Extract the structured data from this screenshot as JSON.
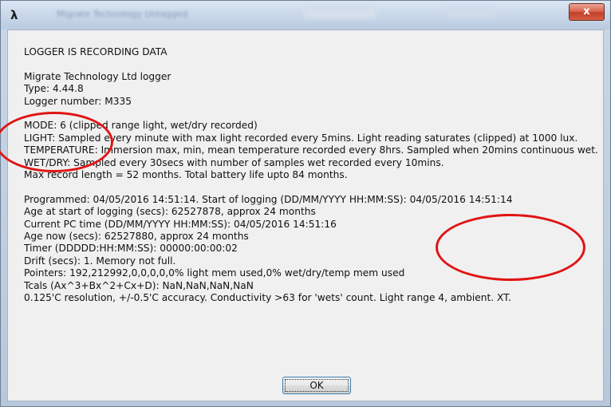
{
  "window": {
    "title": "Migrate Technology Untagged",
    "close_label": "x"
  },
  "message": {
    "status": "LOGGER IS RECORDING DATA",
    "device_name": "Migrate Technology Ltd logger",
    "type": "Type: 4.44.8",
    "logger_number": "Logger number: M335",
    "mode": "MODE: 6 (clipped range light, wet/dry recorded)",
    "light": "LIGHT: Sampled every minute with max light recorded every 5mins. Light reading saturates (clipped) at 1000 lux.",
    "temperature": "TEMPERATURE: Immersion max, min, mean temperature recorded every 8hrs. Sampled when 20mins continuous wet.",
    "wet_dry": "WET/DRY: Sampled every 30secs with number of samples wet recorded every 10mins.",
    "record_length": "Max record length = 52 months. Total battery life upto 84 months.",
    "programmed": "Programmed: 04/05/2016 14:51:14. Start of logging (DD/MM/YYYY HH:MM:SS): 04/05/2016 14:51:14",
    "age_at_start": "Age at start of logging (secs): 62527878, approx 24 months",
    "current_pc_time": "Current PC time (DD/MM/YYYY HH:MM:SS): 04/05/2016 14:51:16",
    "age_now": "Age now (secs): 62527880, approx 24 months",
    "timer": "Timer (DDDDD:HH:MM:SS): 00000:00:00:02",
    "drift": "Drift (secs): 1. Memory not full.",
    "pointers": "Pointers: 192,212992,0,0,0,0,0% light mem used,0% wet/dry/temp mem used",
    "tcals": "Tcals (Ax^3+Bx^2+Cx+D): NaN,NaN,NaN,NaN",
    "resolution": "0.125'C resolution, +/-0.5'C accuracy. Conductivity >63 for 'wets' count. Light range 4, ambient. XT."
  },
  "ok_button": {
    "label": "OK"
  },
  "annotation_color": "#e01414"
}
